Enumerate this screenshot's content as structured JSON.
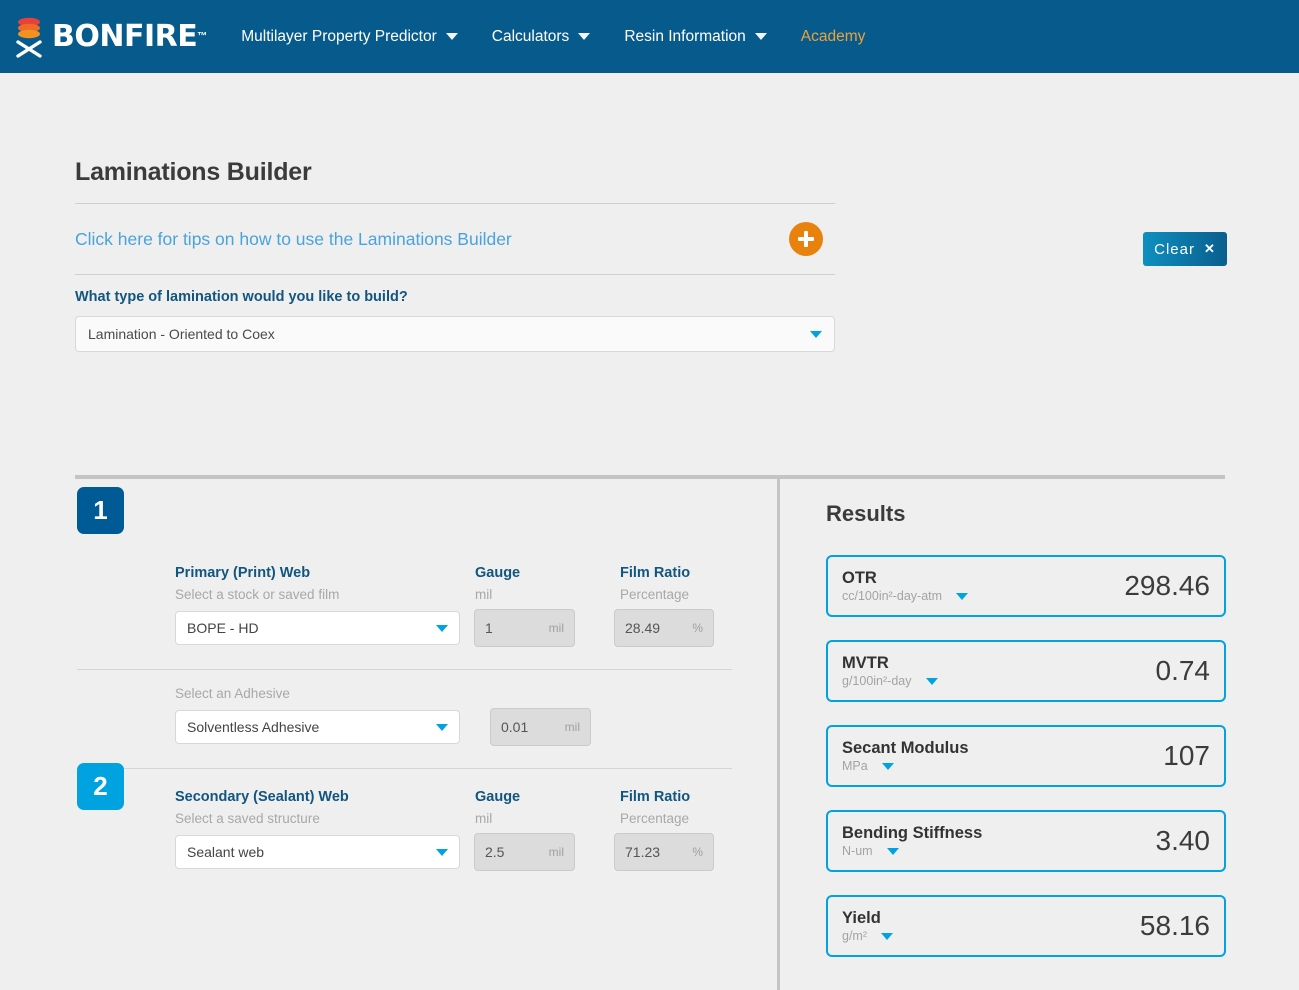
{
  "nav": {
    "brand": {
      "name": "BONFIRE",
      "tm": "™",
      "logo_icon": "stacked-layers-icon"
    },
    "items": [
      {
        "label": "Multilayer Property Predictor",
        "has_caret": true,
        "accent": false
      },
      {
        "label": "Calculators",
        "has_caret": true,
        "accent": false
      },
      {
        "label": "Resin Information",
        "has_caret": true,
        "accent": false
      },
      {
        "label": "Academy",
        "has_caret": false,
        "accent": true
      }
    ]
  },
  "header": {
    "title": "Laminations Builder",
    "tips_link": "Click here for tips on how to use the Laminations Builder",
    "plus_icon": "plus-icon",
    "clear_label": "Clear",
    "clear_x": "✕"
  },
  "lamination": {
    "question": "What type of lamination would you like to build?",
    "selected": "Lamination - Oriented to Coex"
  },
  "builder": {
    "rows": [
      {
        "step": "1",
        "web_title": "Primary (Print) Web",
        "web_sub": "Select a stock or saved film",
        "web_value": "BOPE - HD",
        "gauge_title": "Gauge",
        "gauge_sub": "mil",
        "gauge_value": "1",
        "gauge_unit": "mil",
        "ratio_title": "Film Ratio",
        "ratio_sub": "Percentage",
        "ratio_value": "28.49",
        "ratio_unit": "%"
      },
      {
        "step": "2",
        "web_title": "Secondary (Sealant) Web",
        "web_sub": "Select a saved structure",
        "web_value": "Sealant web",
        "gauge_title": "Gauge",
        "gauge_sub": "mil",
        "gauge_value": "2.5",
        "gauge_unit": "mil",
        "ratio_title": "Film Ratio",
        "ratio_sub": "Percentage",
        "ratio_value": "71.23",
        "ratio_unit": "%"
      }
    ],
    "adhesive": {
      "label": "Select an Adhesive",
      "value": "Solventless Adhesive",
      "gauge_value": "0.01",
      "gauge_unit": "mil"
    }
  },
  "results": {
    "title": "Results",
    "cards": [
      {
        "name": "OTR",
        "unit": "cc/100in²-day-atm",
        "value": "298.46"
      },
      {
        "name": "MVTR",
        "unit": "g/100in²-day",
        "value": "0.74"
      },
      {
        "name": "Secant Modulus",
        "unit": "MPa",
        "value": "107"
      },
      {
        "name": "Bending Stiffness",
        "unit": "N-um",
        "value": "3.40"
      },
      {
        "name": "Yield",
        "unit": "g/m²",
        "value": "58.16"
      }
    ]
  },
  "colors": {
    "nav_blue": "#075b8c",
    "accent_cyan": "#00a3e0",
    "accent_orange": "#e8820c",
    "step1_blue": "#005a96",
    "link_blue": "#4aa3dd",
    "page_bg": "#efefef"
  }
}
